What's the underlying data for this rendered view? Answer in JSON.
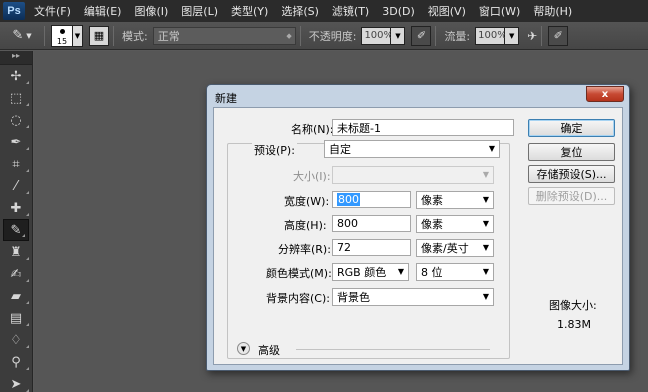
{
  "app": {
    "logo": "Ps"
  },
  "menu": [
    "文件(F)",
    "编辑(E)",
    "图像(I)",
    "图层(L)",
    "类型(Y)",
    "选择(S)",
    "滤镜(T)",
    "3D(D)",
    "视图(V)",
    "窗口(W)",
    "帮助(H)"
  ],
  "options_bar": {
    "brush_size": "15",
    "mode_label": "模式:",
    "mode_value": "正常",
    "opacity_label": "不透明度:",
    "opacity_value": "100%",
    "flow_label": "流量:",
    "flow_value": "100%"
  },
  "tools": [
    "move-tool-icon",
    "marquee-tool-icon",
    "lasso-tool-icon",
    "quick-select-tool-icon",
    "crop-tool-icon",
    "eyedropper-tool-icon",
    "spot-heal-tool-icon",
    "brush-tool-icon",
    "clone-stamp-tool-icon",
    "history-brush-tool-icon",
    "eraser-tool-icon",
    "gradient-tool-icon",
    "blur-tool-icon",
    "dodge-tool-icon",
    "pen-tool-icon"
  ],
  "dialog": {
    "title": "新建",
    "close": "x",
    "name_label": "名称(N):",
    "name_value": "未标题-1",
    "preset_label": "预设(P):",
    "preset_value": "自定",
    "size_label": "大小(I):",
    "width_label": "宽度(W):",
    "width_value": "800",
    "width_unit": "像素",
    "height_label": "高度(H):",
    "height_value": "800",
    "height_unit": "像素",
    "resolution_label": "分辨率(R):",
    "resolution_value": "72",
    "resolution_unit": "像素/英寸",
    "color_mode_label": "颜色模式(M):",
    "color_mode_value": "RGB 颜色",
    "bit_depth_value": "8 位",
    "background_label": "背景内容(C):",
    "background_value": "背景色",
    "advanced_label": "高级",
    "buttons": {
      "ok": "确定",
      "reset": "复位",
      "save_preset": "存储预设(S)...",
      "delete_preset": "删除预设(D)..."
    },
    "image_size_label": "图像大小:",
    "image_size_value": "1.83M"
  }
}
